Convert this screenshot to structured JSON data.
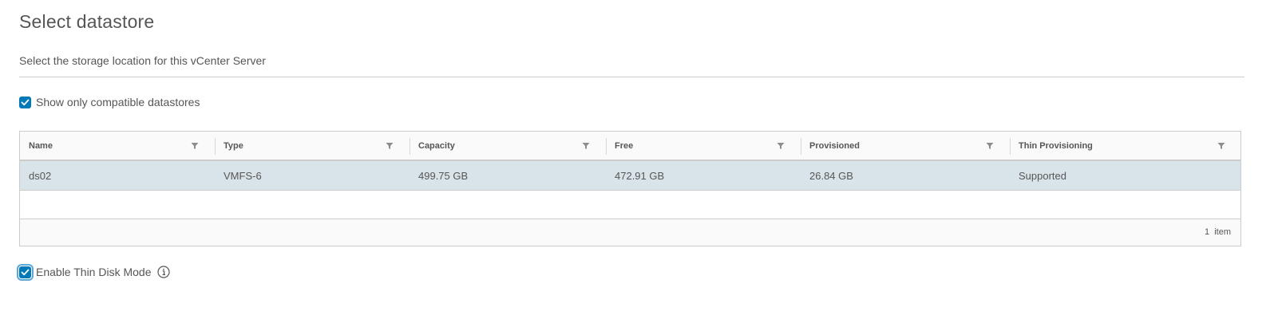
{
  "page": {
    "title": "Select datastore",
    "subtitle": "Select the storage location for this vCenter Server"
  },
  "options": {
    "compatible_label": "Show only compatible datastores",
    "compatible_checked": true,
    "thin_disk_label": "Enable Thin Disk Mode",
    "thin_disk_checked": true
  },
  "grid": {
    "columns": [
      "Name",
      "Type",
      "Capacity",
      "Free",
      "Provisioned",
      "Thin Provisioning"
    ],
    "rows": [
      [
        "ds02",
        "VMFS-6",
        "499.75 GB",
        "472.91 GB",
        "26.84 GB",
        "Supported"
      ]
    ],
    "footer": "1  item"
  },
  "icons": {
    "checkbox": "checkmark-icon",
    "filter": "filter-icon",
    "info": "info-icon"
  },
  "colors": {
    "accent": "#0079b8",
    "selected_row": "#d9e4ea",
    "text": "#565656"
  }
}
